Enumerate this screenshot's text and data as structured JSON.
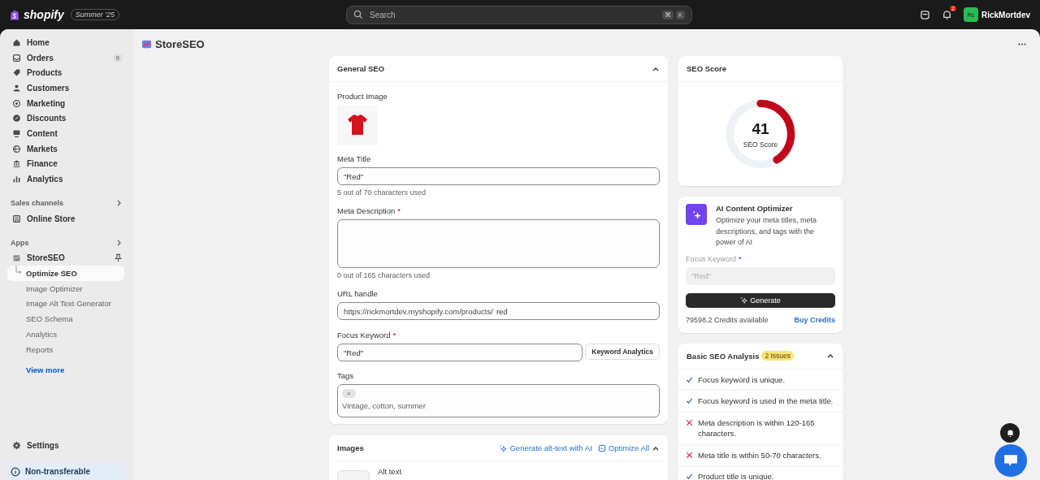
{
  "topbar": {
    "logo": "shopify",
    "edition": "Summer '25",
    "search": {
      "placeholder": "Search",
      "keys": [
        "⌘",
        "K"
      ]
    },
    "notification_count": "2",
    "avatar": "Rc",
    "user": "RickMortdev"
  },
  "sidebar": {
    "items": [
      {
        "label": "Home",
        "selected": false
      },
      {
        "label": "Orders",
        "badge": "9",
        "selected": false
      },
      {
        "label": "Products",
        "selected": false
      },
      {
        "label": "Customers",
        "selected": false
      },
      {
        "label": "Marketing",
        "selected": false
      },
      {
        "label": "Discounts",
        "selected": false
      },
      {
        "label": "Content",
        "selected": false
      },
      {
        "label": "Markets",
        "selected": false
      },
      {
        "label": "Finance",
        "selected": false
      },
      {
        "label": "Analytics",
        "selected": false
      }
    ],
    "sales_channels": {
      "heading": "Sales channels",
      "items": [
        {
          "label": "Online Store"
        }
      ]
    },
    "apps": {
      "heading": "Apps",
      "app": {
        "label": "StoreSEO",
        "children": [
          {
            "label": "Optimize SEO",
            "selected": true
          },
          {
            "label": "Image Optimizer",
            "selected": false
          },
          {
            "label": "Image Alt Text Generator",
            "selected": false
          },
          {
            "label": "SEO Schema",
            "selected": false
          },
          {
            "label": "Analytics",
            "selected": false
          },
          {
            "label": "Reports",
            "selected": false
          }
        ]
      },
      "view_more": "View more"
    },
    "settings": "Settings",
    "footer": "Non-transferable"
  },
  "page": {
    "title": "StoreSEO"
  },
  "general_seo": {
    "title": "General SEO",
    "expanded": true,
    "product_image_label": "Product Image",
    "meta_title": {
      "label": "Meta Title",
      "value": "\"Red\"",
      "hint": "5 out of 70 characters used"
    },
    "meta_description": {
      "label": "Meta Description",
      "required_mark": "*",
      "hint": "0 out of 165 characters used"
    },
    "url_handle": {
      "label": "URL handle",
      "prefix": "https://rickmortdev.myshopify.com/products/",
      "value": "red"
    },
    "focus_keyword": {
      "label": "Focus Keyword",
      "required_mark": "*",
      "value": "\"Red\"",
      "button": "Keyword Analytics"
    },
    "tags": {
      "label": "Tags",
      "chip_remove": "×",
      "placeholder": "Vintage, cotton, summer"
    }
  },
  "images": {
    "title": "Images",
    "actions": [
      "Generate alt-text with AI",
      "Optimize All"
    ],
    "expanded": true,
    "column": "Alt text"
  },
  "seo_score": {
    "title": "SEO Score",
    "score": "41",
    "caption": "SEO Score",
    "level": 0.41
  },
  "ai_optimizer": {
    "title": "AI Content Optimizer",
    "description": "Optimize your meta titles, meta descriptions, and tags with the power of AI",
    "keyword_label": "Focus Keyword",
    "required_mark": "*",
    "keyword_value": "\"Red\"",
    "button": "Generate",
    "credits": "79598.2 Credits available",
    "buy": "Buy Credits"
  },
  "analysis": {
    "title": "Basic SEO Analysis",
    "issues": "2 Issues",
    "expanded": true,
    "checks": [
      {
        "text": "Focus keyword is unique.",
        "passed": true
      },
      {
        "text": "Focus keyword is used in the meta title.",
        "passed": true
      },
      {
        "text": "Meta description is within 120-165 characters.",
        "passed": false
      },
      {
        "text": "Meta title is within 50-70 characters.",
        "passed": false
      },
      {
        "text": "Product title is unique.",
        "passed": true
      }
    ]
  }
}
